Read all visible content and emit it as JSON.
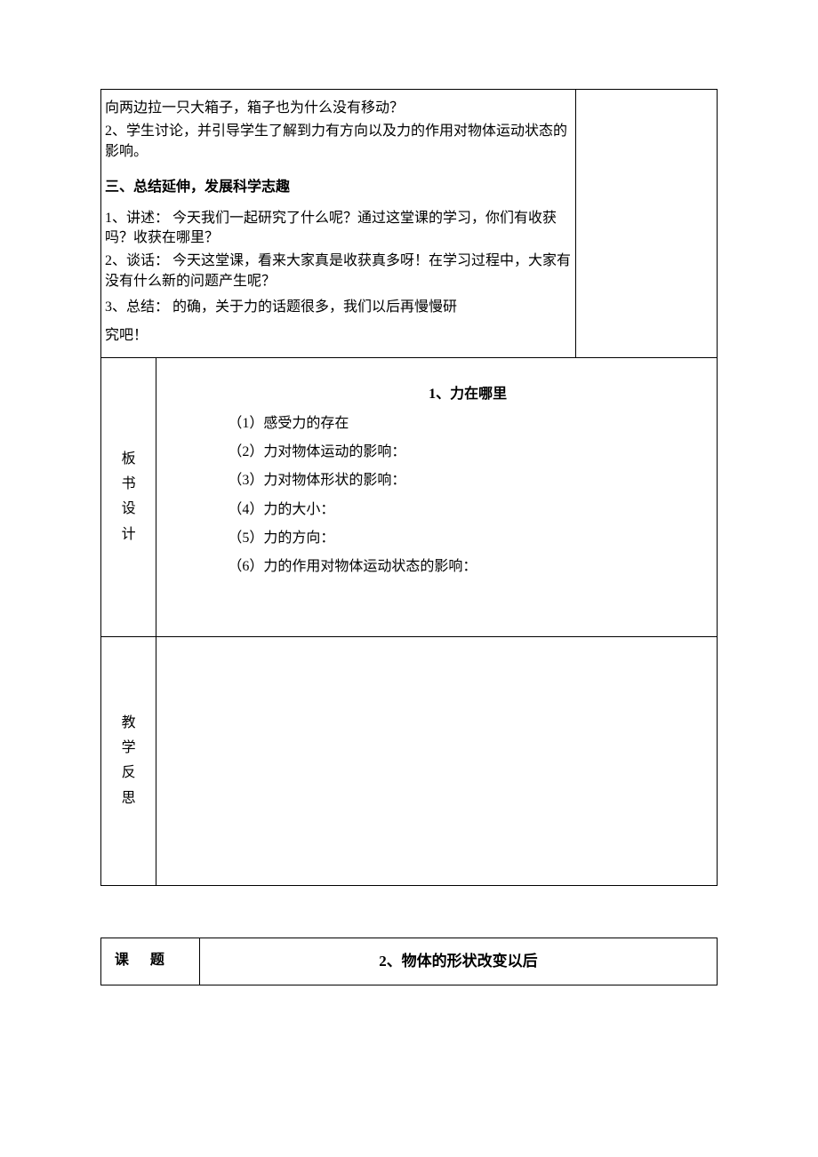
{
  "top": {
    "lines": [
      "向两边拉一只大箱子，箱子也为什么没有移动？",
      "2、学生讨论，并引导学生了解到力有方向以及力的作用对物体运动状态的影响。"
    ],
    "section_heading": "三、总结延伸，发展科学志趣",
    "q1": "1、讲述：  今天我们一起研究了什么呢？通过这堂课的学习，你们有收获吗？收获在哪里？",
    "q2": "2、谈话：  今天这堂课，看来大家真是收获真多呀！在学习过程中，大家有没有什么新的问题产生呢？",
    "q3a": "3、总结：  的确，关于力的话题很多，我们以后再慢慢研",
    "q3b": "究吧！"
  },
  "design": {
    "label_chars": [
      "板",
      "书",
      "设",
      "计"
    ],
    "title": "1、力在哪里",
    "items": [
      "（1）感受力的存在",
      "（2）力对物体运动的影响：",
      "（3）力对物体形状的影响：",
      "（4）力的大小：",
      "（5）力的方向：",
      "（6）力的作用对物体运动状态的影响："
    ]
  },
  "reflect": {
    "label_chars": [
      "教",
      "学",
      "反",
      "思"
    ]
  },
  "bottom": {
    "label": "课题",
    "title": "2、物体的形状改变以后"
  }
}
